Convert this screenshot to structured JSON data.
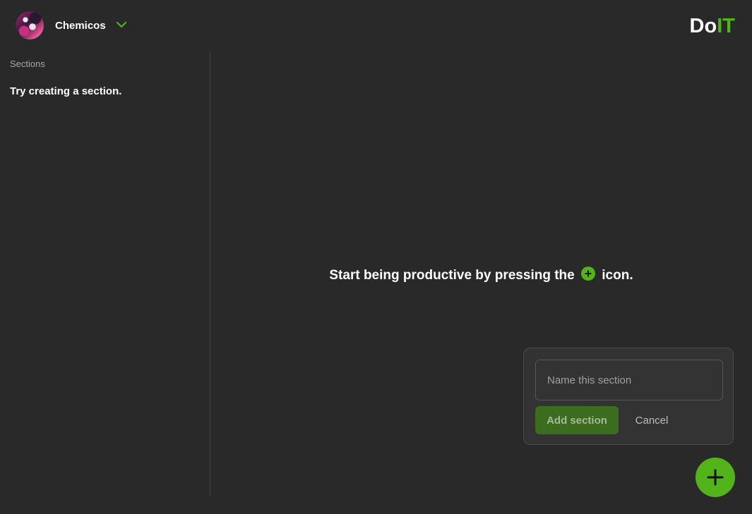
{
  "header": {
    "user_name": "Chemicos",
    "user_menu_icon": "chevron-down-icon",
    "logo": {
      "part1": "Do",
      "part2": "IT"
    }
  },
  "sidebar": {
    "title": "Sections",
    "empty_text": "Try creating a section."
  },
  "main": {
    "empty_message_before": "Start being productive by pressing the",
    "empty_message_icon": "plus-circle-icon",
    "empty_message_after": "icon."
  },
  "add_section_popup": {
    "input_placeholder": "Name this section",
    "input_value": "",
    "add_label": "Add section",
    "cancel_label": "Cancel"
  },
  "fab": {
    "icon": "plus-icon"
  },
  "colors": {
    "background": "#292929",
    "accent": "#52b31b",
    "accent_dim": "#3c6d1f",
    "popup_bg": "#333333",
    "divider": "#444444"
  }
}
